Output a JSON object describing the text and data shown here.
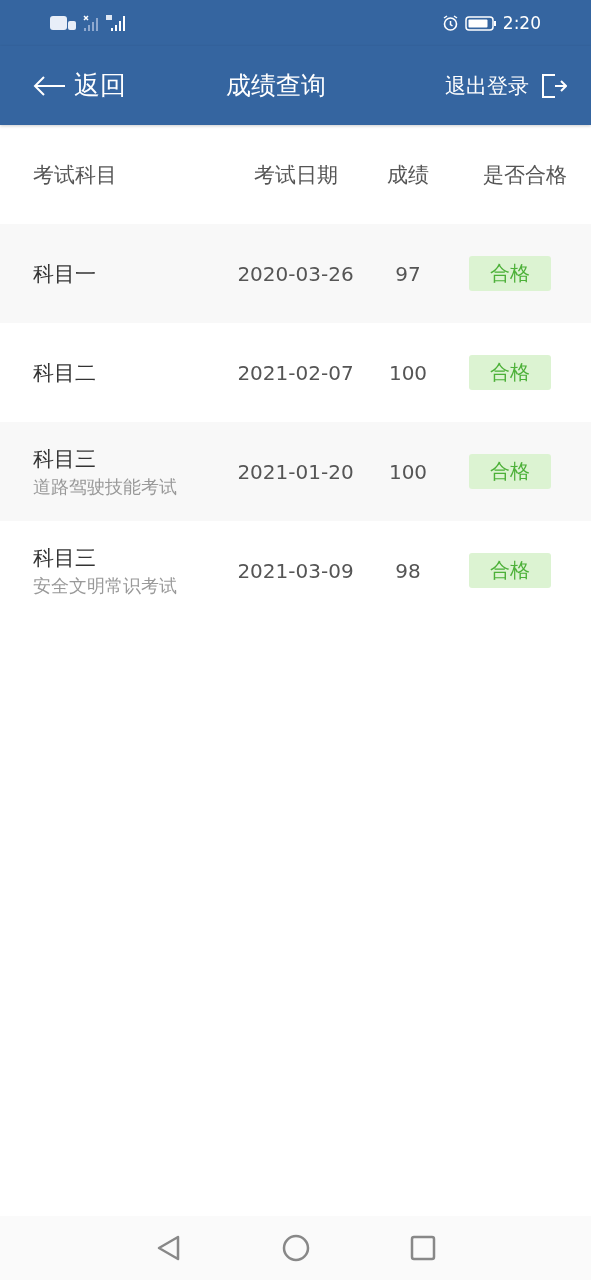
{
  "status_bar": {
    "time": "2:20"
  },
  "header": {
    "back": "返回",
    "title": "成绩查询",
    "logout": "退出登录"
  },
  "table": {
    "columns": [
      "考试科目",
      "考试日期",
      "成绩",
      "是否合格"
    ],
    "rows": [
      {
        "subject": "科目一",
        "date": "2020-03-26",
        "score": "97",
        "result": "合格",
        "passed": true
      },
      {
        "subject": "科目二",
        "date": "2021-02-07",
        "score": "100",
        "result": "合格",
        "passed": true
      },
      {
        "subject": "科目三",
        "detail": "道路驾驶技能考试",
        "date": "2021-01-20",
        "score": "100",
        "result": "合格",
        "passed": true
      },
      {
        "subject": "科目三",
        "detail": "安全文明常识考试",
        "date": "2021-03-09",
        "score": "98",
        "result": "合格",
        "passed": true
      }
    ]
  }
}
